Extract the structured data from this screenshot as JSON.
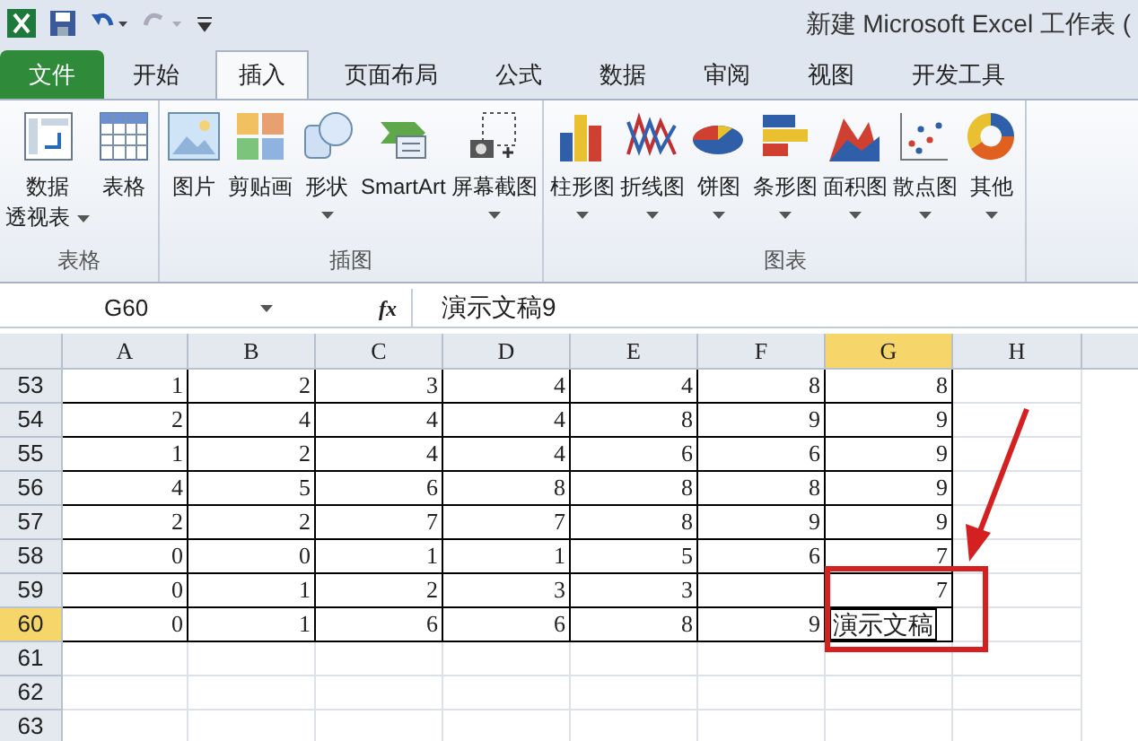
{
  "window": {
    "title": "新建 Microsoft Excel 工作表 ("
  },
  "tabs": [
    {
      "label": "文件",
      "kind": "file",
      "selected": false
    },
    {
      "label": "开始",
      "kind": "tab",
      "selected": false
    },
    {
      "label": "插入",
      "kind": "tab",
      "selected": true
    },
    {
      "label": "页面布局",
      "kind": "tab",
      "selected": false
    },
    {
      "label": "公式",
      "kind": "tab",
      "selected": false
    },
    {
      "label": "数据",
      "kind": "tab",
      "selected": false
    },
    {
      "label": "审阅",
      "kind": "tab",
      "selected": false
    },
    {
      "label": "视图",
      "kind": "tab",
      "selected": false
    },
    {
      "label": "开发工具",
      "kind": "tab",
      "selected": false
    }
  ],
  "ribbon_groups": [
    {
      "label": "表格",
      "buttons": [
        {
          "label": "数据",
          "label_2": "透视表",
          "dropdown": true
        },
        {
          "label": "表格",
          "dropdown": false
        }
      ]
    },
    {
      "label": "插图",
      "buttons": [
        {
          "label": "图片",
          "dropdown": false
        },
        {
          "label": "剪贴画",
          "dropdown": false
        },
        {
          "label": "形状",
          "dropdown": true
        },
        {
          "label": "SmartArt",
          "dropdown": false
        },
        {
          "label": "屏幕截图",
          "dropdown": true
        }
      ]
    },
    {
      "label": "图表",
      "buttons": [
        {
          "label": "柱形图",
          "dropdown": true
        },
        {
          "label": "折线图",
          "dropdown": true
        },
        {
          "label": "饼图",
          "dropdown": true
        },
        {
          "label": "条形图",
          "dropdown": true
        },
        {
          "label": "面积图",
          "dropdown": true
        },
        {
          "label": "散点图",
          "dropdown": true
        },
        {
          "label": "其他",
          "dropdown": true
        }
      ]
    }
  ],
  "formula_bar": {
    "name_box": "G60",
    "fx": "fx",
    "value": "演示文稿9"
  },
  "sheet": {
    "columns": [
      {
        "label": "A",
        "selected": false
      },
      {
        "label": "B",
        "selected": false
      },
      {
        "label": "C",
        "selected": false
      },
      {
        "label": "D",
        "selected": false
      },
      {
        "label": "E",
        "selected": false
      },
      {
        "label": "F",
        "selected": false
      },
      {
        "label": "G",
        "selected": true
      },
      {
        "label": "H",
        "selected": false
      }
    ],
    "rows": [
      {
        "header": "53",
        "selected": false,
        "cells": [
          "1",
          "2",
          "3",
          "4",
          "4",
          "8",
          "8"
        ]
      },
      {
        "header": "54",
        "selected": false,
        "cells": [
          "2",
          "4",
          "4",
          "4",
          "8",
          "9",
          "9"
        ]
      },
      {
        "header": "55",
        "selected": false,
        "cells": [
          "1",
          "2",
          "4",
          "4",
          "6",
          "6",
          "9"
        ]
      },
      {
        "header": "56",
        "selected": false,
        "cells": [
          "4",
          "5",
          "6",
          "8",
          "8",
          "8",
          "9"
        ]
      },
      {
        "header": "57",
        "selected": false,
        "cells": [
          "2",
          "2",
          "7",
          "7",
          "8",
          "9",
          "9"
        ]
      },
      {
        "header": "58",
        "selected": false,
        "cells": [
          "0",
          "0",
          "1",
          "1",
          "5",
          "6",
          "7"
        ]
      },
      {
        "header": "59",
        "selected": false,
        "cells": [
          "0",
          "1",
          "2",
          "3",
          "3",
          null,
          "7"
        ]
      },
      {
        "header": "60",
        "selected": true,
        "cells": [
          "0",
          "1",
          "6",
          "6",
          "8",
          "9",
          null
        ]
      },
      {
        "header": "61",
        "selected": false,
        "cells": []
      },
      {
        "header": "62",
        "selected": false,
        "cells": []
      },
      {
        "header": "63",
        "selected": false,
        "cells": []
      }
    ],
    "editing_cell": {
      "value": "演示文稿"
    }
  }
}
